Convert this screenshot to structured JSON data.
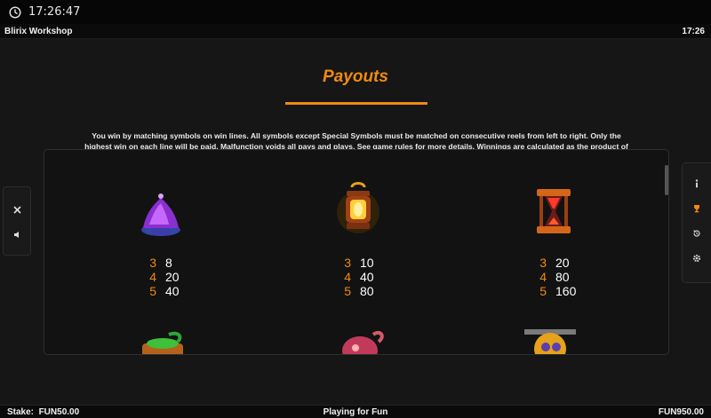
{
  "status_bar": {
    "time": "17:26:47",
    "icon": "clock-icon"
  },
  "header": {
    "game_name": "Blirix Workshop",
    "clock": "17:26"
  },
  "paytable_page": {
    "title": "Payouts",
    "description": "You win by matching symbols on win lines. All symbols except Special Symbols must be matched on consecutive reels from left to right. Only the highest win on each line will be paid. Malfunction voids all pays and plays. See game rules for more details. Winnings are calculated as the product of the multiplier shown in the paytable and Stake, divided by the number of win lines."
  },
  "left_panel": {
    "close_icon": "close-icon",
    "sound_icon": "speaker-icon"
  },
  "right_panel": {
    "icons": [
      "info-icon",
      "trophy-icon",
      "history-icon",
      "settings-gear-icon"
    ]
  },
  "symbols": [
    {
      "name": "purple-mushroom-symbol",
      "pays": [
        {
          "count": "3",
          "mult": "8"
        },
        {
          "count": "4",
          "mult": "20"
        },
        {
          "count": "5",
          "mult": "40"
        }
      ]
    },
    {
      "name": "lantern-symbol",
      "pays": [
        {
          "count": "3",
          "mult": "10"
        },
        {
          "count": "4",
          "mult": "40"
        },
        {
          "count": "5",
          "mult": "80"
        }
      ]
    },
    {
      "name": "hourglass-symbol",
      "pays": [
        {
          "count": "3",
          "mult": "20"
        },
        {
          "count": "4",
          "mult": "80"
        },
        {
          "count": "5",
          "mult": "160"
        }
      ]
    }
  ],
  "partial_symbols": [
    "green-teapot-symbol",
    "pink-octopus-symbol",
    "gold-machine-symbol"
  ],
  "footer": {
    "stake_label": "Stake:",
    "stake_value": "FUN50.00",
    "mode": "Playing for Fun",
    "balance": "FUN950.00"
  },
  "colors": {
    "accent": "#f08a12",
    "background": "#161616",
    "panel": "#121212"
  }
}
